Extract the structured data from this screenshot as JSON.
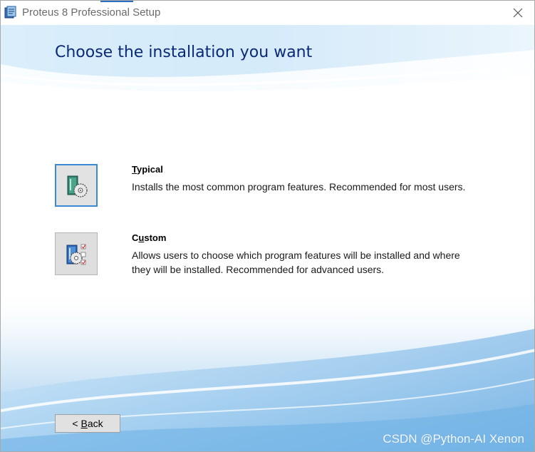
{
  "window": {
    "title": "Proteus 8 Professional Setup",
    "close_icon": "close-icon"
  },
  "page": {
    "heading": "Choose the installation you want"
  },
  "options": [
    {
      "title_prefix": "T",
      "title_rest": "ypical",
      "description": "Installs the most common program features. Recommended for most users.",
      "icon": "typical-install-icon",
      "selected": true
    },
    {
      "title_prefix": "C",
      "title_underlined": "u",
      "title_rest": "stom",
      "description": "Allows users to choose which program features will be installed and where they will be installed. Recommended for advanced users.",
      "icon": "custom-install-icon",
      "selected": false
    }
  ],
  "buttons": {
    "back_arrow": "< ",
    "back_mnemonic": "B",
    "back_rest": "ack"
  },
  "watermark": "CSDN @Python-AI Xenon",
  "colors": {
    "heading": "#0a2a78",
    "accent_border": "#3a8ad6",
    "swoosh": "#8fc4ec"
  }
}
